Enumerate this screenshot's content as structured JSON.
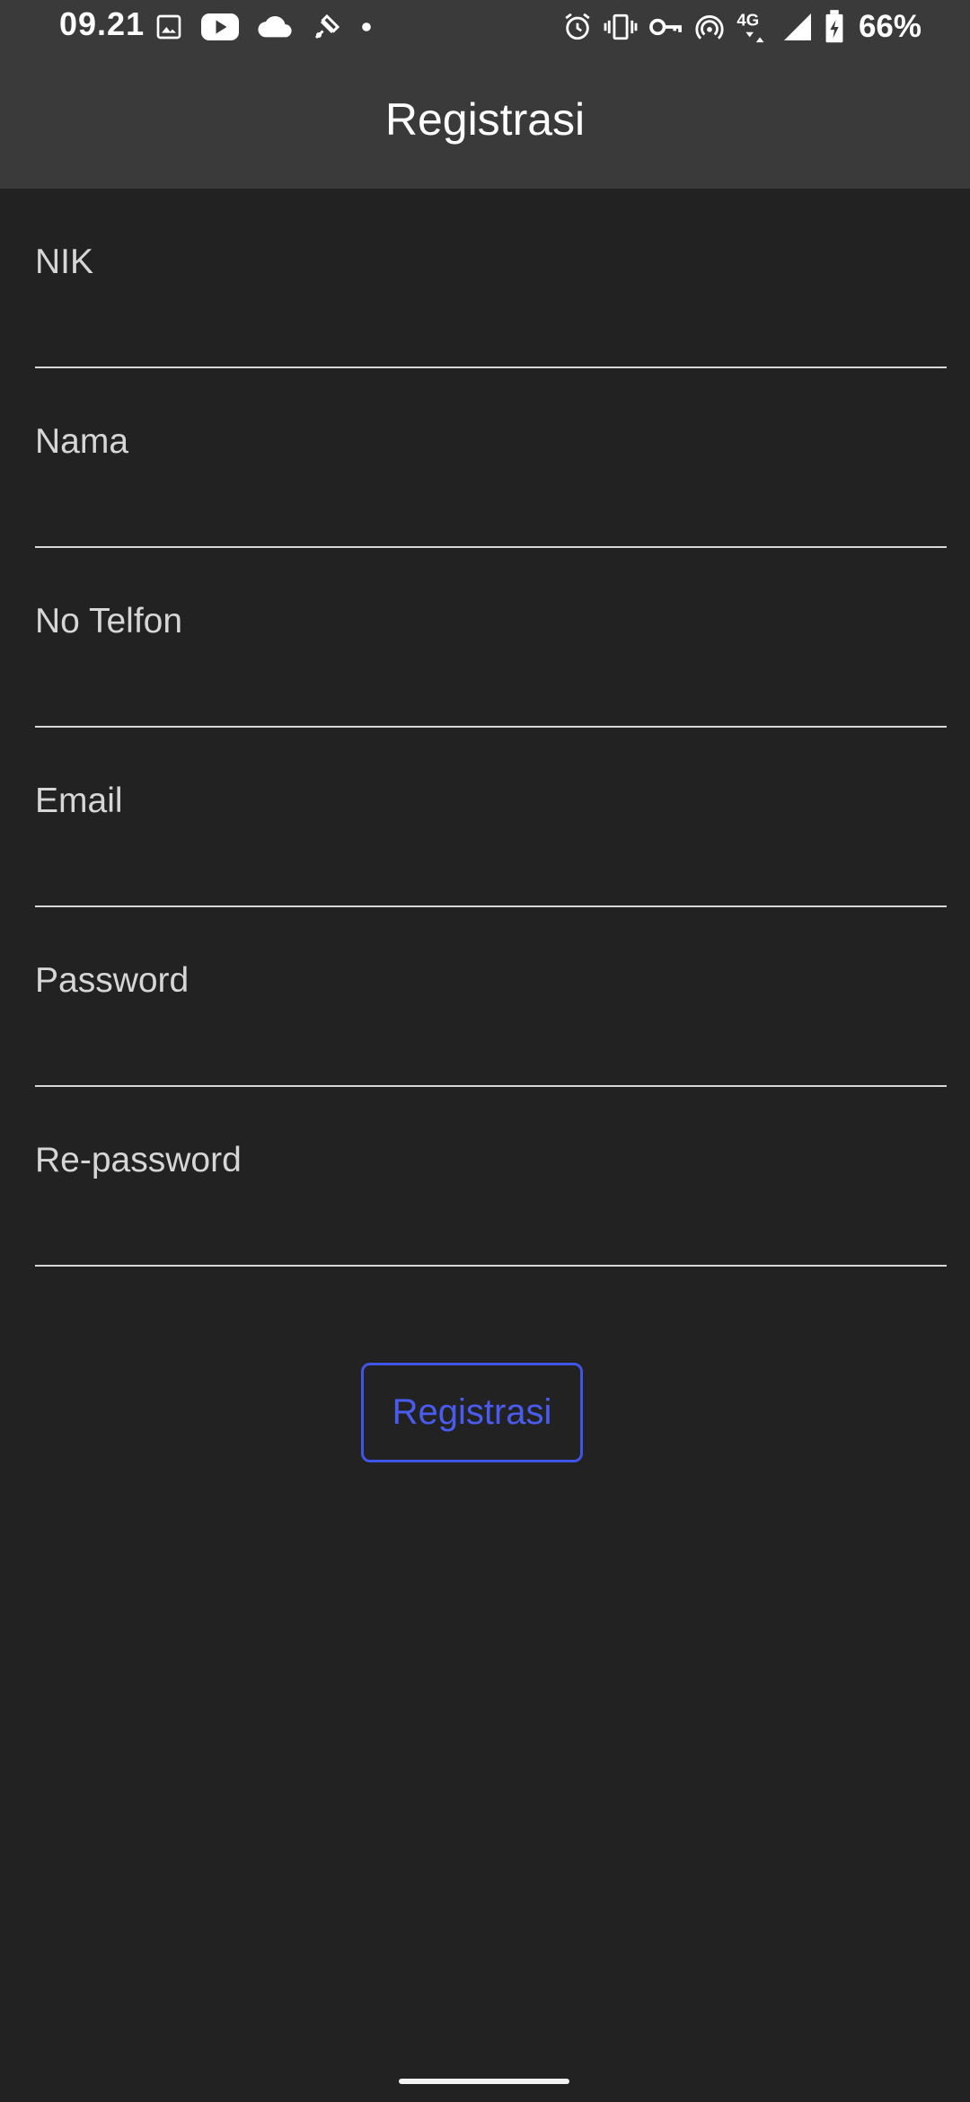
{
  "status_bar": {
    "time": "09.21",
    "network": "4G",
    "battery": "66%",
    "left_icons": [
      "image-icon",
      "youtube-icon",
      "cloud-icon",
      "satellite-icon",
      "dot-icon"
    ],
    "right_icons": [
      "alarm-icon",
      "vibrate-icon",
      "vpn-key-icon",
      "hotspot-icon",
      "network-4g-icon",
      "signal-icon",
      "battery-icon"
    ]
  },
  "app_bar": {
    "title": "Registrasi"
  },
  "form": {
    "fields": [
      {
        "label": "NIK",
        "value": ""
      },
      {
        "label": "Nama",
        "value": ""
      },
      {
        "label": "No Telfon",
        "value": ""
      },
      {
        "label": "Email",
        "value": ""
      },
      {
        "label": "Password",
        "value": ""
      },
      {
        "label": "Re-password",
        "value": ""
      }
    ],
    "submit_label": "Registrasi"
  },
  "colors": {
    "background": "#222222",
    "app_bar": "#3a3a3a",
    "accent": "#4154e8",
    "underline": "#d8d8d8"
  }
}
